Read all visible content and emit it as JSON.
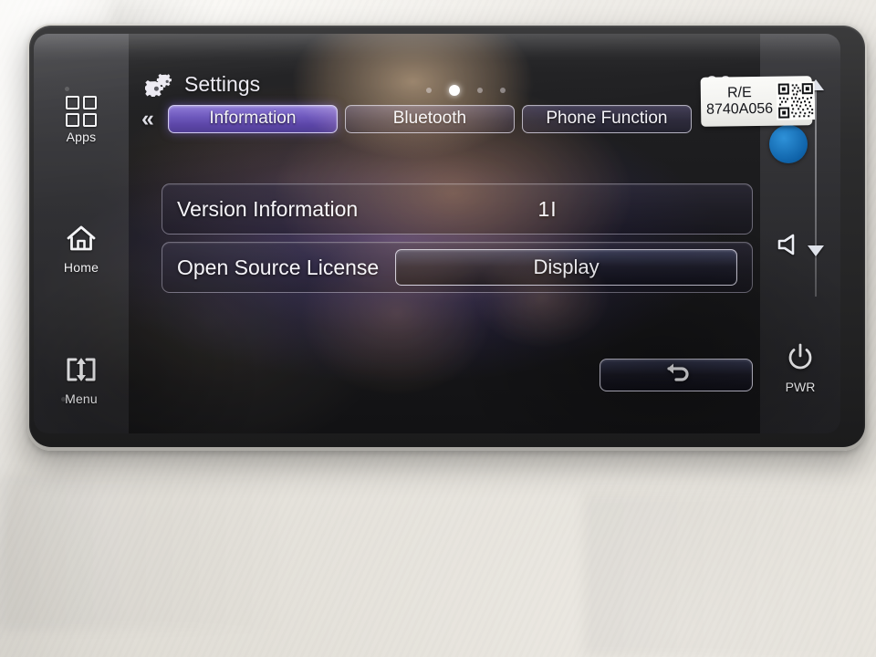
{
  "device": {
    "type": "car-infotainment-head-unit"
  },
  "header": {
    "title": "Settings",
    "gear_icon": "gears-icon",
    "clock": "00",
    "page_dots": {
      "count": 4,
      "active_index": 1
    }
  },
  "tabbar": {
    "prev_arrow": "«",
    "tabs": [
      {
        "label": "Information",
        "active": true
      },
      {
        "label": "Bluetooth",
        "active": false
      },
      {
        "label": "Phone Function",
        "active": false
      }
    ]
  },
  "left_rail": {
    "items": [
      {
        "label": "Apps",
        "icon": "apps-grid-icon"
      },
      {
        "label": "Home",
        "icon": "home-icon"
      },
      {
        "label": "Menu",
        "icon": "menu-updown-icon"
      }
    ]
  },
  "right_rail": {
    "volume_up_icon": "triangle-up-icon",
    "volume_down_icon": "triangle-down-icon",
    "speaker_icon": "speaker-icon",
    "power": {
      "label": "PWR",
      "icon": "power-icon"
    },
    "accent_color": "#1268ac"
  },
  "content": {
    "rows": [
      {
        "label": "Version Information",
        "value": "1I",
        "kind": "value"
      },
      {
        "label": "Open Source License",
        "button": "Display",
        "kind": "button"
      }
    ]
  },
  "footer": {
    "back_icon": "back-arrow-icon"
  },
  "sticker": {
    "line1": "R/E",
    "line2": "8740A056",
    "qr_icon": "qr-code-icon"
  },
  "colors": {
    "active_tab": "#6d57bd",
    "screen_glow": "#5c48a8",
    "blue_dot": "#1268ac"
  }
}
